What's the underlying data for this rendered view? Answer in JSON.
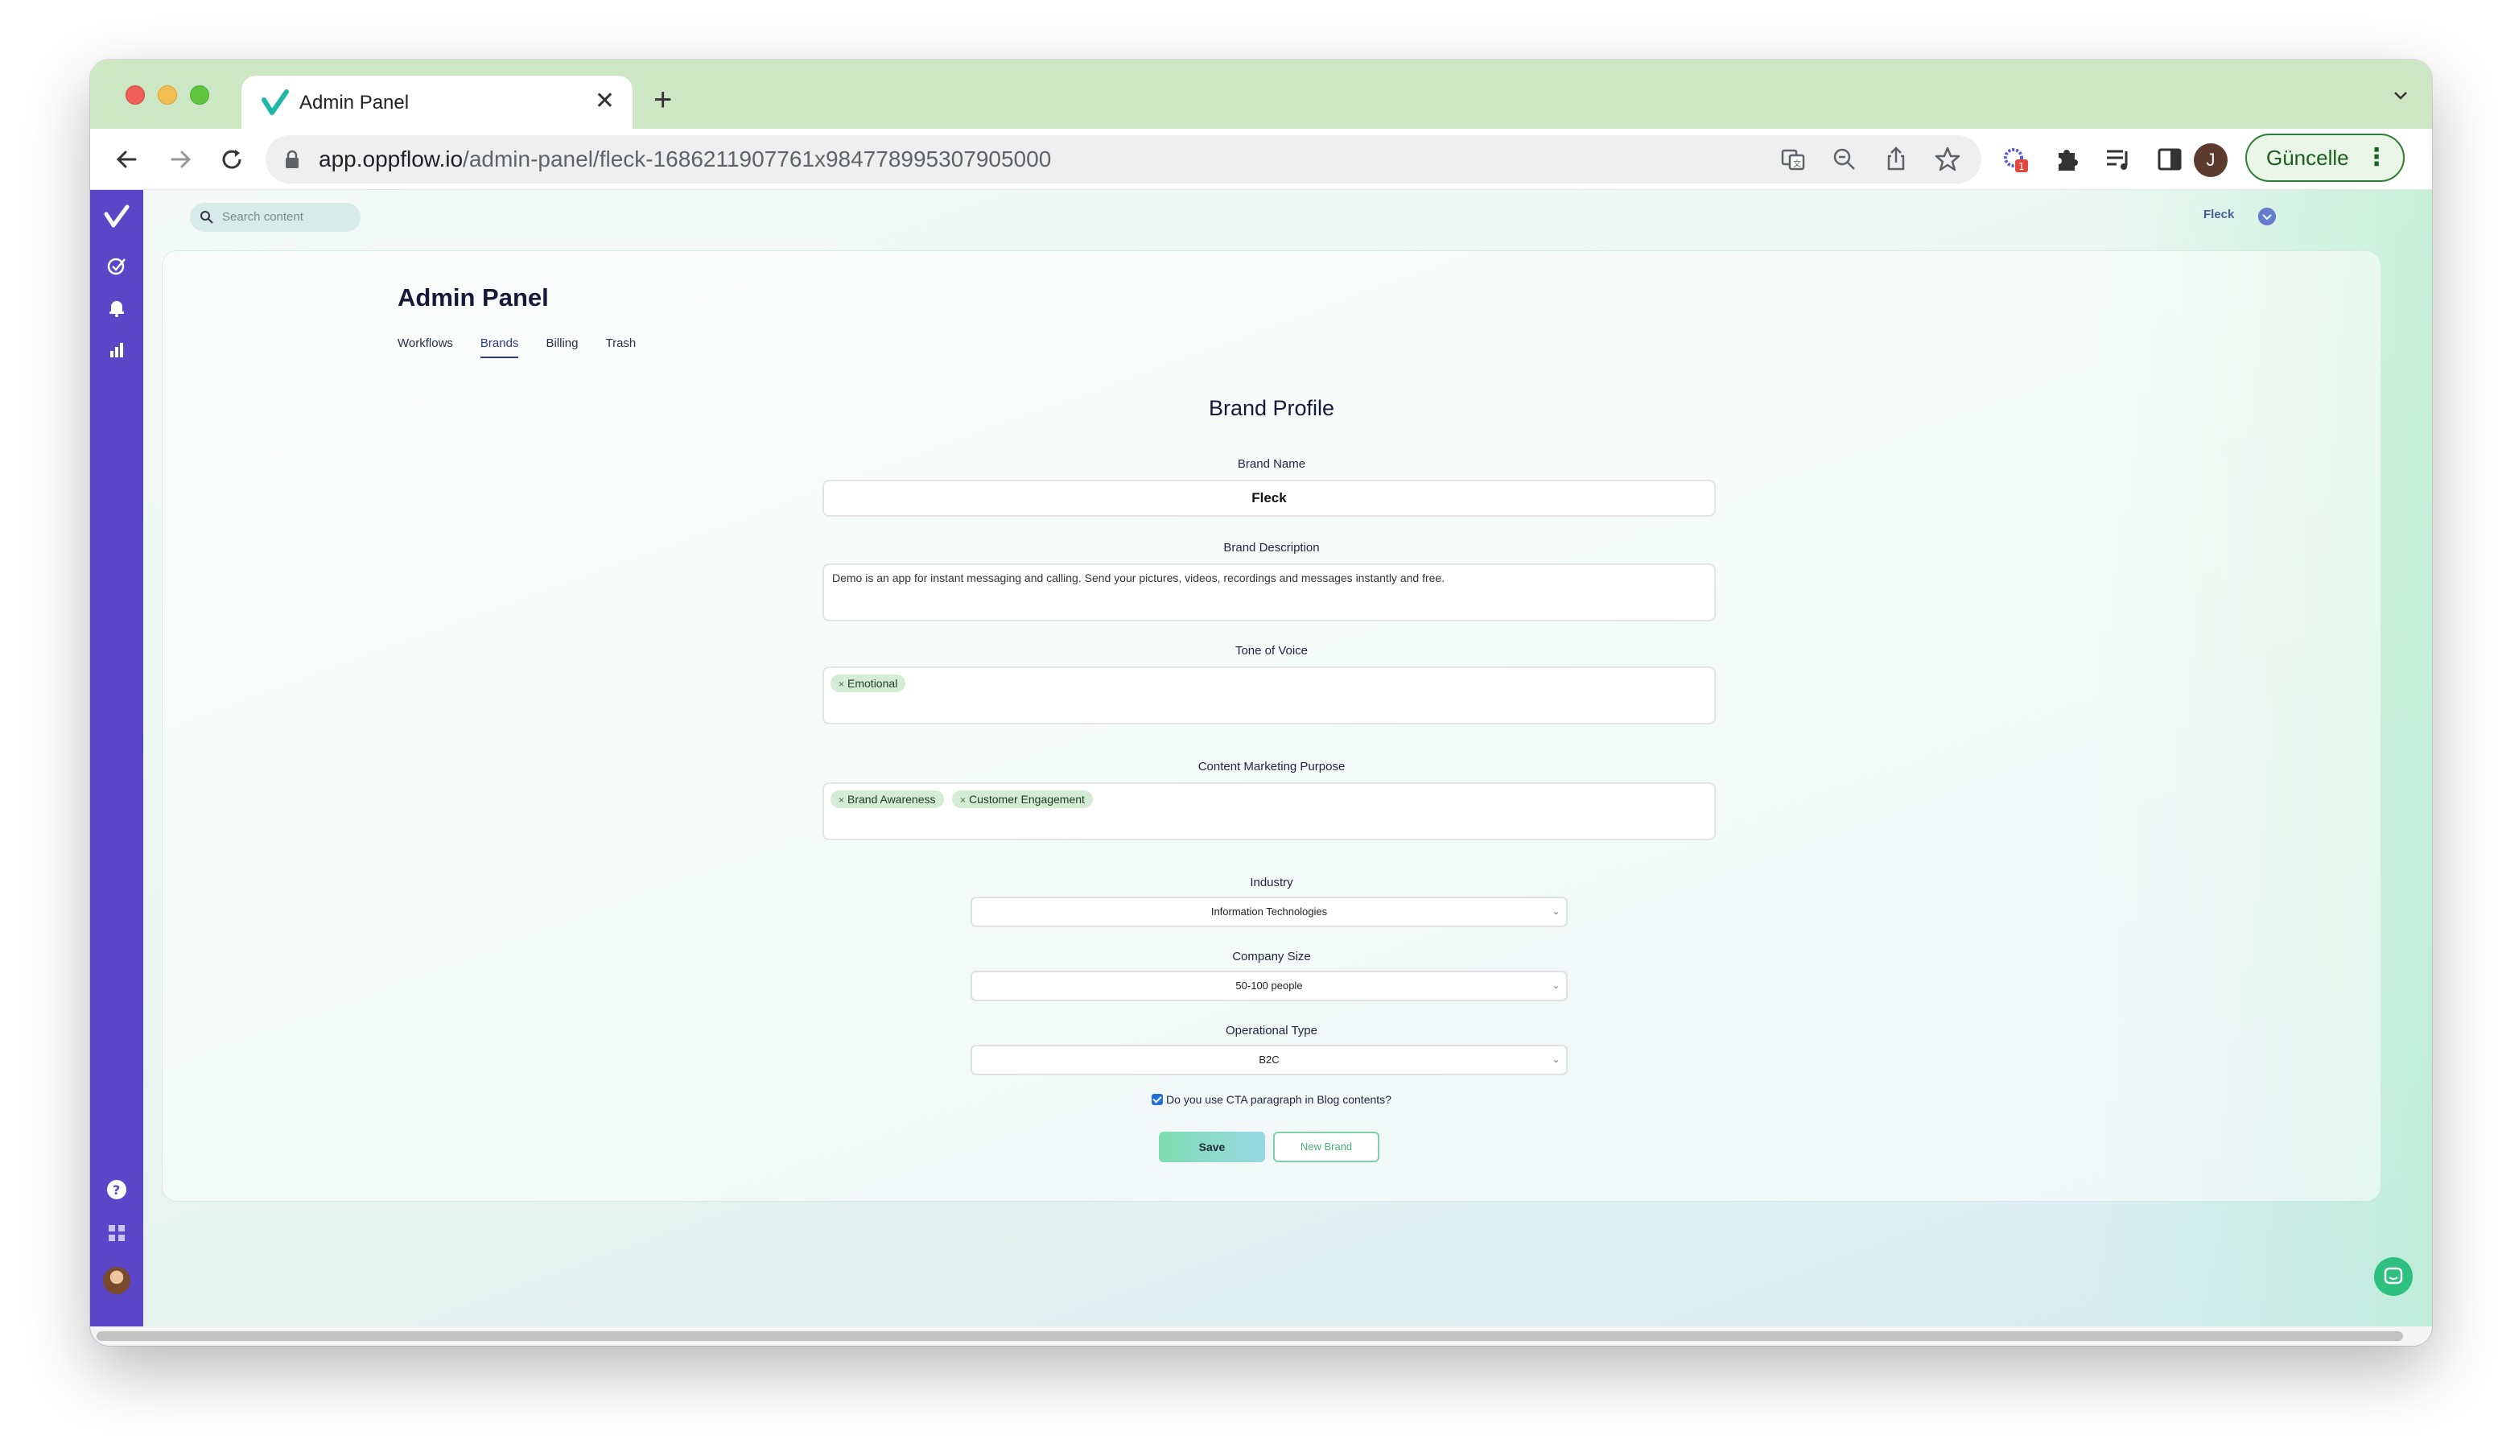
{
  "browser": {
    "tab_title": "Admin Panel",
    "url_host": "app.oppflow.io",
    "url_path": "/admin-panel/fleck-1686211907761x984778995307905000",
    "extension_badge": "1",
    "profile_initial": "J",
    "update_button_label": "Güncelle"
  },
  "topbar": {
    "search_placeholder": "Search content",
    "brand_selector": "Fleck"
  },
  "page": {
    "title": "Admin Panel",
    "tabs": [
      {
        "label": "Workflows",
        "active": false
      },
      {
        "label": "Brands",
        "active": true
      },
      {
        "label": "Billing",
        "active": false
      },
      {
        "label": "Trash",
        "active": false
      }
    ]
  },
  "form": {
    "title": "Brand Profile",
    "brand_name_label": "Brand Name",
    "brand_name_value": "Fleck",
    "brand_description_label": "Brand Description",
    "brand_description_value": "Demo is an app for instant messaging and calling. Send your pictures, videos, recordings and messages instantly and free.",
    "tone_label": "Tone of Voice",
    "tone_tags": [
      "Emotional"
    ],
    "purpose_label": "Content Marketing Purpose",
    "purpose_tags": [
      "Brand Awareness",
      "Customer Engagement"
    ],
    "industry_label": "Industry",
    "industry_value": "Information Technologies",
    "company_size_label": "Company Size",
    "company_size_value": "50-100 people",
    "operational_type_label": "Operational Type",
    "operational_type_value": "B2C",
    "cta_checkbox_label": "Do you use CTA paragraph in Blog contents?",
    "cta_checked": true,
    "save_label": "Save",
    "new_brand_label": "New Brand",
    "tag_remove_glyph": "×",
    "select_chevron_glyph": "⌄"
  },
  "colors": {
    "sidebar": "#5b46c8",
    "accent_green": "#2ec07e",
    "tag_bg": "#d3ecd3",
    "primary_text": "#151a3a"
  }
}
